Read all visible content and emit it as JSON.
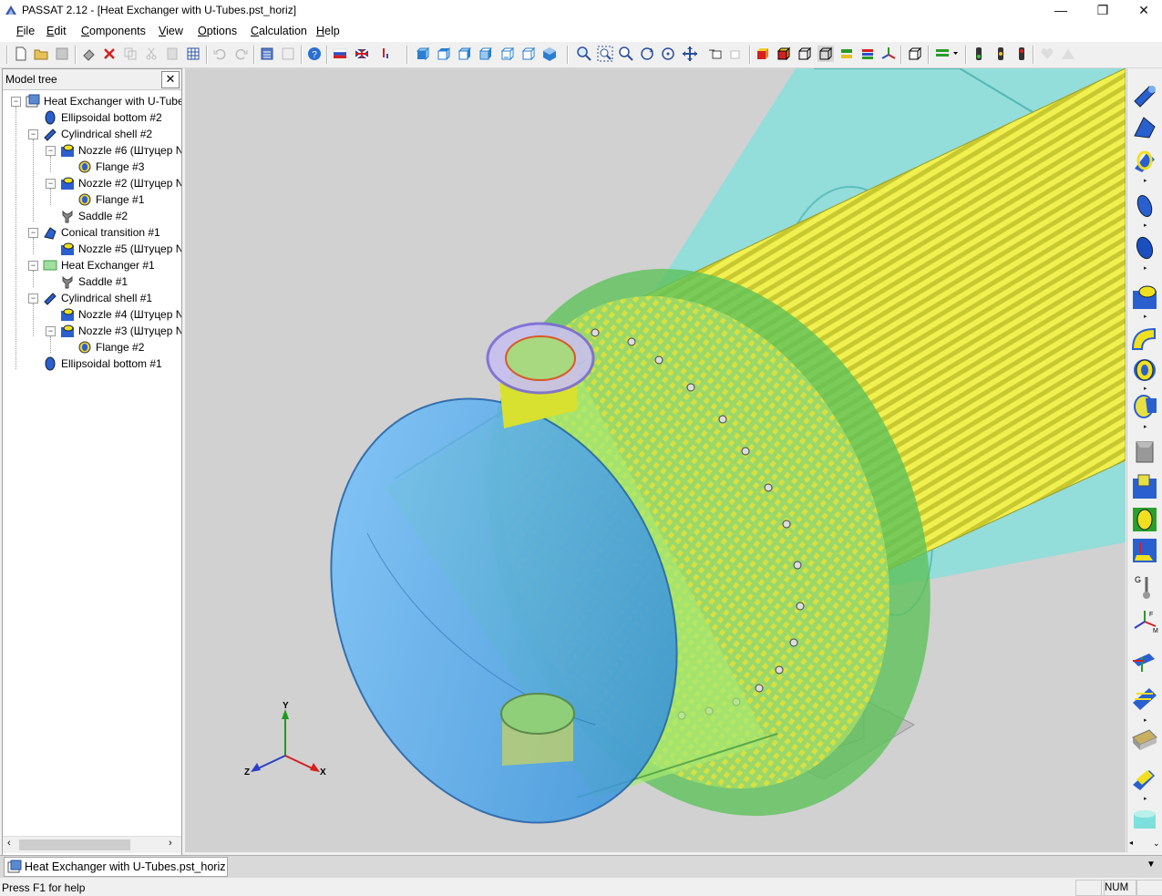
{
  "window": {
    "title": "PASSAT 2.12 - [Heat Exchanger with U-Tubes.pst_horiz]",
    "minimize_glyph": "—",
    "restore_glyph": "❐",
    "close_glyph": "✕"
  },
  "menu": [
    "File",
    "Edit",
    "Components",
    "View",
    "Options",
    "Calculation",
    "Help"
  ],
  "model_tree": {
    "title": "Model tree",
    "close_glyph": "✕",
    "items": [
      {
        "label": "Heat Exchanger with U-Tube",
        "icon": "project-icon"
      },
      {
        "label": "Ellipsoidal bottom #2",
        "icon": "ellipsoidal-bottom-icon"
      },
      {
        "label": "Cylindrical shell #2",
        "icon": "cylindrical-shell-icon"
      },
      {
        "label": "Nozzle #6 (Штуцер N",
        "icon": "nozzle-icon"
      },
      {
        "label": "Flange #3",
        "icon": "flange-icon"
      },
      {
        "label": "Nozzle #2 (Штуцер N",
        "icon": "nozzle-icon"
      },
      {
        "label": "Flange #1",
        "icon": "flange-icon"
      },
      {
        "label": "Saddle #2",
        "icon": "saddle-icon"
      },
      {
        "label": "Conical transition #1",
        "icon": "conical-transition-icon"
      },
      {
        "label": "Nozzle #5 (Штуцер N",
        "icon": "nozzle-icon"
      },
      {
        "label": "Heat Exchanger #1",
        "icon": "heat-exchanger-icon"
      },
      {
        "label": "Saddle #1",
        "icon": "saddle-icon"
      },
      {
        "label": "Cylindrical shell #1",
        "icon": "cylindrical-shell-icon"
      },
      {
        "label": "Nozzle #4 (Штуцер N",
        "icon": "nozzle-icon"
      },
      {
        "label": "Nozzle #3 (Штуцер N",
        "icon": "nozzle-icon"
      },
      {
        "label": "Flange #2",
        "icon": "flange-icon"
      },
      {
        "label": "Ellipsoidal bottom #1",
        "icon": "ellipsoidal-bottom-icon"
      }
    ]
  },
  "viewport": {
    "axes": {
      "y": "Y",
      "x": "X",
      "z": "Z"
    },
    "colors": {
      "background": "#d1d1d1",
      "shell": "#7ee0dc",
      "tubes": "#e2e23a",
      "tubesheet": "#5ec25a",
      "head": "#3a9be0"
    }
  },
  "document_tab": "Heat Exchanger with U-Tubes.pst_horiz",
  "status": {
    "help": "Press F1 for help",
    "num": "NUM"
  }
}
